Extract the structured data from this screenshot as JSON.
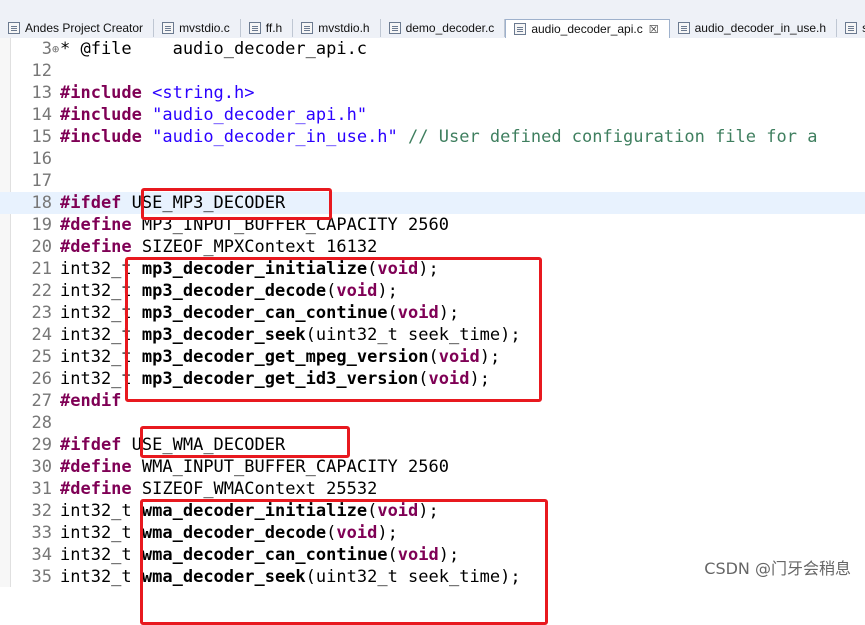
{
  "tabs": [
    {
      "label": "Andes Project Creator",
      "active": false
    },
    {
      "label": "mvstdio.c",
      "active": false
    },
    {
      "label": "ff.h",
      "active": false
    },
    {
      "label": "mvstdio.h",
      "active": false
    },
    {
      "label": "demo_decoder.c",
      "active": false
    },
    {
      "label": "audio_decoder_api.c",
      "active": true,
      "close": "☒"
    },
    {
      "label": "audio_decoder_in_use.h",
      "active": false
    },
    {
      "label": "s",
      "active": false
    }
  ],
  "editor": {
    "lines": [
      {
        "num": "3",
        "fold": "⊕",
        "text": "* @file    audio_decoder_api.c"
      },
      {
        "num": "12",
        "text": ""
      },
      {
        "num": "13",
        "kw": "#include",
        "rest_str": "<string.h>"
      },
      {
        "num": "14",
        "kw": "#include",
        "rest_str": "\"audio_decoder_api.h\""
      },
      {
        "num": "15",
        "kw": "#include",
        "rest_str": "\"audio_decoder_in_use.h\"",
        "comment": "// User defined configuration file for a"
      },
      {
        "num": "16",
        "text": ""
      },
      {
        "num": "17",
        "text": ""
      },
      {
        "num": "18",
        "kw": "#ifdef",
        "rest": "USE_MP3_DECODER",
        "highlight": true
      },
      {
        "num": "19",
        "kw": "#define",
        "rest": "MP3_INPUT_BUFFER_CAPACITY 2560"
      },
      {
        "num": "20",
        "kw": "#define",
        "rest": "SIZEOF_MPXContext 16132"
      },
      {
        "num": "21",
        "type": "int32_t",
        "fn": "mp3_decoder_initialize",
        "args_kw": "void",
        "tail": ";"
      },
      {
        "num": "22",
        "type": "int32_t",
        "fn": "mp3_decoder_decode",
        "args_kw": "void",
        "tail": ";"
      },
      {
        "num": "23",
        "type": "int32_t",
        "fn": "mp3_decoder_can_continue",
        "args_kw": "void",
        "tail": ";"
      },
      {
        "num": "24",
        "type": "int32_t",
        "fn": "mp3_decoder_seek",
        "args_plain": "uint32_t seek_time",
        "tail": ";"
      },
      {
        "num": "25",
        "type": "int32_t",
        "fn": "mp3_decoder_get_mpeg_version",
        "args_kw": "void",
        "tail": ";"
      },
      {
        "num": "26",
        "type": "int32_t",
        "fn": "mp3_decoder_get_id3_version",
        "args_kw": "void",
        "tail": ";"
      },
      {
        "num": "27",
        "kw": "#endif",
        "rest": ""
      },
      {
        "num": "28",
        "text": ""
      },
      {
        "num": "29",
        "kw": "#ifdef",
        "rest": "USE_WMA_DECODER"
      },
      {
        "num": "30",
        "kw": "#define",
        "rest": "WMA_INPUT_BUFFER_CAPACITY 2560"
      },
      {
        "num": "31",
        "kw": "#define",
        "rest": "SIZEOF_WMAContext 25532"
      },
      {
        "num": "32",
        "type": "int32_t",
        "fn": "wma_decoder_initialize",
        "args_kw": "void",
        "tail": ";"
      },
      {
        "num": "33",
        "type": "int32_t",
        "fn": "wma_decoder_decode",
        "args_kw": "void",
        "tail": ";"
      },
      {
        "num": "34",
        "type": "int32_t",
        "fn": "wma_decoder_can_continue",
        "args_kw": "void",
        "tail": ";"
      },
      {
        "num": "35",
        "type": "int32_t",
        "fn": "wma_decoder_seek",
        "args_plain": "uint32_t seek_time",
        "tail": ");"
      }
    ]
  },
  "watermark": "CSDN @门牙会稍息",
  "colors": {
    "annotation_box": "#e8191f",
    "keyword": "#7f0055",
    "string": "#2a00ff",
    "comment": "#3f7f5f"
  }
}
